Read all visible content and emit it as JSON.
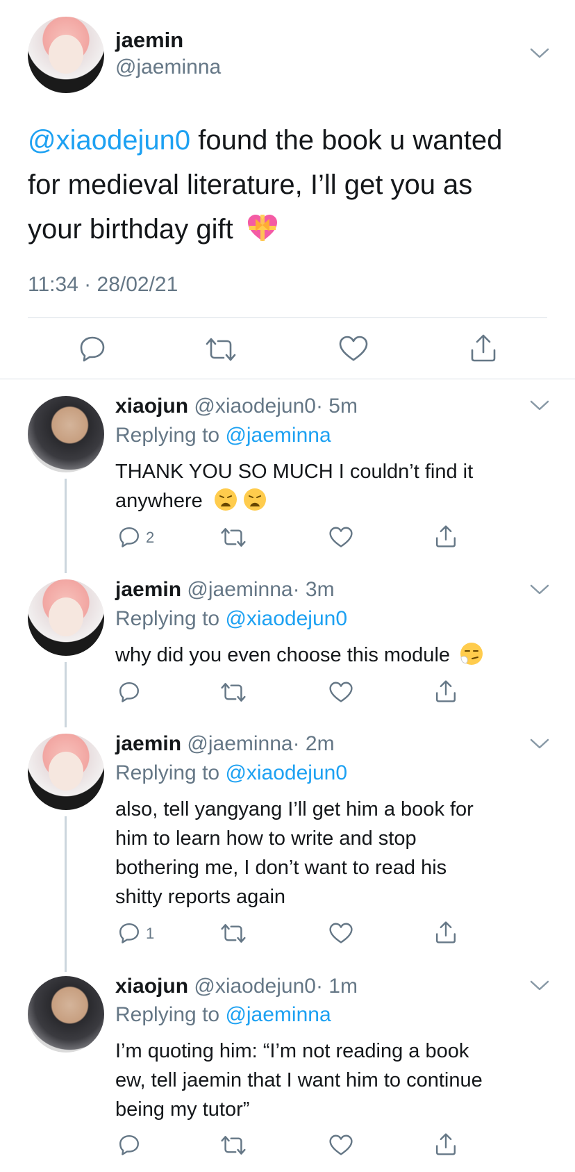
{
  "main_tweet": {
    "name": "jaemin",
    "handle": "@jaeminna",
    "mention": "@xiaodejun0",
    "text_line1_rest": " found the book u wanted",
    "text_line2": "for medieval literature, I’ll get you as",
    "text_line3": "your birthday gift",
    "emoji": "heart-with-ribbon",
    "timestamp": "11:34 · 28/02/21"
  },
  "replies": [
    {
      "name": "xiaojun",
      "handle": "@xiaodejun0",
      "time": "· 5m",
      "replying_prefix": "Replying to",
      "replying_to": "@jaeminna",
      "lines": [
        "THANK YOU SO MUCH I couldn’t find it",
        "anywhere"
      ],
      "emojis": [
        "weary-face",
        "weary-face"
      ],
      "reply_count": "2"
    },
    {
      "name": "jaemin",
      "handle": "@jaeminna",
      "time": "· 3m",
      "replying_prefix": "Replying to",
      "replying_to": "@xiaodejun0",
      "lines": [
        "why did you even choose this module"
      ],
      "emojis": [
        "sneezing-face"
      ],
      "reply_count": ""
    },
    {
      "name": "jaemin",
      "handle": "@jaeminna",
      "time": "· 2m",
      "replying_prefix": "Replying to",
      "replying_to": "@xiaodejun0",
      "lines": [
        "also, tell yangyang I’ll get him a book for",
        "him to learn how to write and stop",
        "bothering me, I don’t want to read his",
        "shitty reports again"
      ],
      "emojis": [],
      "reply_count": "1"
    },
    {
      "name": "xiaojun",
      "handle": "@xiaodejun0",
      "time": "· 1m",
      "replying_prefix": "Replying to",
      "replying_to": "@jaeminna",
      "lines": [
        "I’m quoting him: “I’m not reading a book",
        "ew, tell jaemin that I want him to continue",
        "being my tutor”"
      ],
      "emojis": [],
      "reply_count": ""
    }
  ],
  "colors": {
    "accent": "#1da1f2",
    "muted": "#657786",
    "divider": "#e1e8ed",
    "thread_line": "#ccd6dd"
  },
  "icons": [
    "chevron-down-icon",
    "reply-icon",
    "retweet-icon",
    "like-icon",
    "share-icon"
  ]
}
